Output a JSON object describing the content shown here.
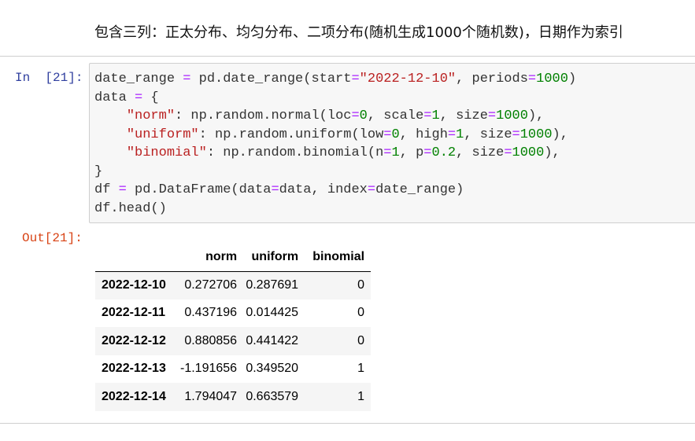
{
  "markdown_cell": {
    "text": "包含三列：正太分布、均匀分布、二项分布(随机生成1000个随机数)，日期作为索引"
  },
  "code_cell": {
    "in_prompt": "In  [21]:",
    "out_prompt": "Out[21]:",
    "lines": [
      "date_range = pd.date_range(start=\"2022-12-10\", periods=1000)",
      "data = {",
      "    \"norm\": np.random.normal(loc=0, scale=1, size=1000),",
      "    \"uniform\": np.random.uniform(low=0, high=1, size=1000),",
      "    \"binomial\": np.random.binomial(n=1, p=0.2, size=1000),",
      "}",
      "df = pd.DataFrame(data=data, index=date_range)",
      "df.head()"
    ]
  },
  "output_table": {
    "columns": [
      "",
      "norm",
      "uniform",
      "binomial"
    ],
    "rows": [
      {
        "index": "2022-12-10",
        "norm": "0.272706",
        "uniform": "0.287691",
        "binomial": "0"
      },
      {
        "index": "2022-12-11",
        "norm": "0.437196",
        "uniform": "0.014425",
        "binomial": "0"
      },
      {
        "index": "2022-12-12",
        "norm": "0.880856",
        "uniform": "0.441422",
        "binomial": "0"
      },
      {
        "index": "2022-12-13",
        "norm": "-1.191656",
        "uniform": "0.349520",
        "binomial": "1"
      },
      {
        "index": "2022-12-14",
        "norm": "1.794047",
        "uniform": "0.663579",
        "binomial": "1"
      }
    ]
  },
  "colors": {
    "in_prompt": "#303f9f",
    "out_prompt": "#d84315",
    "string": "#ba2121",
    "number": "#008000",
    "operator": "#aa22ff"
  }
}
